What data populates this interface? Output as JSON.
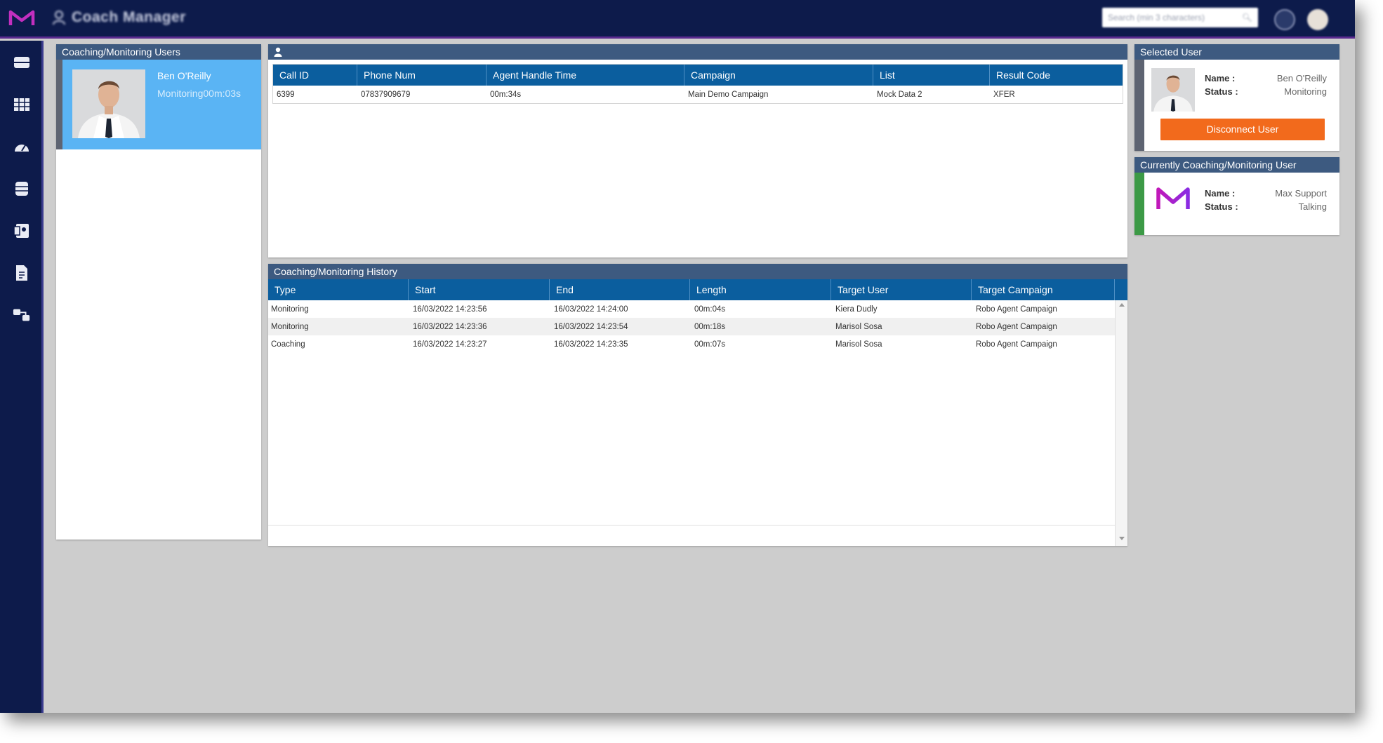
{
  "app": {
    "title": "Coach Manager",
    "search_placeholder": "Search (min 3 characters)"
  },
  "sidebar": {
    "items": [
      {
        "icon": "inbox-icon"
      },
      {
        "icon": "table-icon"
      },
      {
        "icon": "gauge-icon"
      },
      {
        "icon": "database-icon"
      },
      {
        "icon": "contacts-icon"
      },
      {
        "icon": "document-icon"
      },
      {
        "icon": "network-icon"
      }
    ]
  },
  "users_panel": {
    "title": "Coaching/Monitoring Users",
    "user": {
      "name": "Ben O'Reilly",
      "state": "Monitoring00m:03s"
    }
  },
  "calls": {
    "columns": [
      "Call ID",
      "Phone Num",
      "Agent Handle Time",
      "Campaign",
      "List",
      "Result Code"
    ],
    "rows": [
      [
        "6399",
        "07837909679",
        "00m:34s",
        "Main Demo Campaign",
        "Mock Data 2",
        "XFER"
      ]
    ]
  },
  "history": {
    "title": "Coaching/Monitoring History",
    "columns": [
      "Type",
      "Start",
      "End",
      "Length",
      "Target User",
      "Target Campaign"
    ],
    "rows": [
      [
        "Monitoring",
        "16/03/2022 14:23:56",
        "16/03/2022 14:24:00",
        "00m:04s",
        "Kiera Dudly",
        "Robo Agent Campaign"
      ],
      [
        "Monitoring",
        "16/03/2022 14:23:36",
        "16/03/2022 14:23:54",
        "00m:18s",
        "Marisol Sosa",
        "Robo Agent Campaign"
      ],
      [
        "Coaching",
        "16/03/2022 14:23:27",
        "16/03/2022 14:23:35",
        "00m:07s",
        "Marisol Sosa",
        "Robo Agent Campaign"
      ]
    ]
  },
  "selected_user": {
    "title": "Selected User",
    "name_label": "Name :",
    "status_label": "Status :",
    "name": "Ben O'Reilly",
    "status": "Monitoring",
    "disconnect_label": "Disconnect User"
  },
  "current_user": {
    "title": "Currently Coaching/Monitoring User",
    "name_label": "Name :",
    "status_label": "Status :",
    "name": "Max Support",
    "status": "Talking"
  },
  "colors": {
    "nav": "#0d1b4b",
    "header": "#3d5a80",
    "grid_head": "#0b5e9e",
    "selected_card": "#5ab4f4",
    "disconnect": "#f26a1c",
    "status_green": "#3c9a46"
  }
}
